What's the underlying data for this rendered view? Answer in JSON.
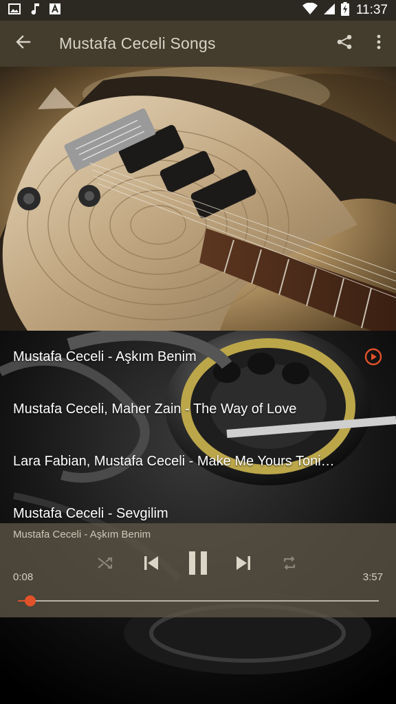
{
  "status_bar": {
    "time": "11:37",
    "icons": [
      "image-icon",
      "music-note-icon",
      "font-a-icon",
      "wifi-icon",
      "signal-icon",
      "battery-charging-icon"
    ]
  },
  "app_bar": {
    "title": "Mustafa Ceceli Songs",
    "back_icon": "arrow-back-icon",
    "share_icon": "share-icon",
    "more_icon": "more-vert-icon"
  },
  "songs": [
    {
      "title": "Mustafa Ceceli - Aşkım Benim",
      "playing": true
    },
    {
      "title": "Mustafa Ceceli, Maher Zain - The Way of Love",
      "playing": false
    },
    {
      "title": "Lara Fabian, Mustafa Ceceli - Make Me Yours Toni…",
      "playing": false
    },
    {
      "title": "Mustafa Ceceli - Sevgilim",
      "playing": false
    }
  ],
  "player": {
    "now_playing": "Mustafa Ceceli - Aşkım Benim",
    "elapsed": "0:08",
    "total": "3:57",
    "progress_fraction": 0.034,
    "accent_color": "#e2522a",
    "controls": [
      "shuffle-icon",
      "skip-previous-icon",
      "pause-icon",
      "skip-next-icon",
      "repeat-icon"
    ]
  }
}
